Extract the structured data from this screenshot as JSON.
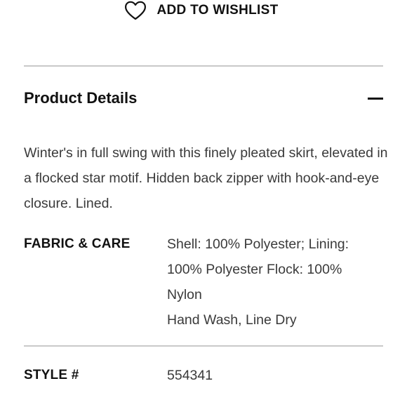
{
  "wishlist": {
    "icon": "heart-outline-icon",
    "label": "ADD TO WISHLIST"
  },
  "product_details": {
    "title": "Product Details",
    "toggle_icon": "minus-icon",
    "description": "Winter's in full swing with this finely pleated skirt, elevated in a flocked star motif. Hidden back zipper with hook-and-eye closure. Lined.",
    "fabric_care": {
      "label": "FABRIC & CARE",
      "composition": "Shell: 100% Polyester; Lining: 100% Polyester Flock: 100% Nylon",
      "care": "Hand Wash, Line Dry"
    },
    "style": {
      "label": "STYLE #",
      "value": "554341"
    }
  },
  "colors": {
    "text_primary": "#111111",
    "text_body": "#3a3a3a",
    "divider": "#c9c9c9",
    "background": "#ffffff"
  }
}
